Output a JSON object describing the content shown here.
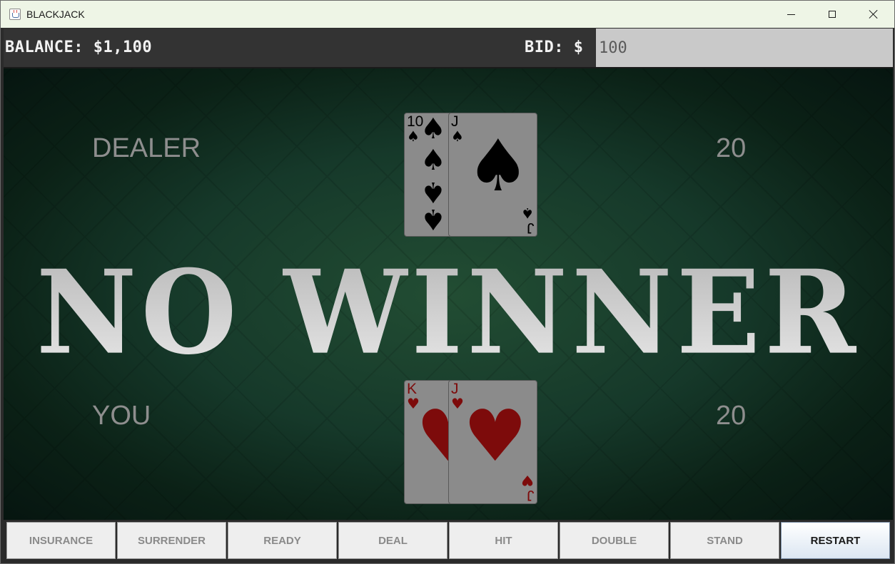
{
  "window": {
    "title": "BLACKJACK",
    "icon": "java-app-icon",
    "controls": [
      "minimize-icon",
      "maximize-icon",
      "close-icon"
    ]
  },
  "infobar": {
    "balance_label": "BALANCE: $1,100",
    "bid_label": "BID: $",
    "bid_value": "100"
  },
  "table": {
    "dealer": {
      "label": "DEALER",
      "score": "20",
      "cards": [
        {
          "rank": "10",
          "suit": "spades",
          "suit_glyph": "♠"
        },
        {
          "rank": "J",
          "suit": "spades",
          "suit_glyph": "♠"
        }
      ]
    },
    "player": {
      "label": "YOU",
      "score": "20",
      "cards": [
        {
          "rank": "K",
          "suit": "hearts",
          "suit_glyph": "♥"
        },
        {
          "rank": "J",
          "suit": "hearts",
          "suit_glyph": "♥"
        }
      ]
    },
    "result": "NO WINNER"
  },
  "buttons": {
    "insurance": "INSURANCE",
    "surrender": "SURRENDER",
    "ready": "READY",
    "deal": "DEAL",
    "hit": "HIT",
    "double": "DOUBLE",
    "stand": "STAND",
    "restart": "RESTART"
  },
  "colors": {
    "felt": "#16392a",
    "info_bar": "#333333",
    "bid_field": "#c9c9c9",
    "card_face": "#8b8b8b",
    "black_suit": "#000000",
    "red_suit": "#7d0b0b",
    "text_muted": "#8e8e8e"
  }
}
